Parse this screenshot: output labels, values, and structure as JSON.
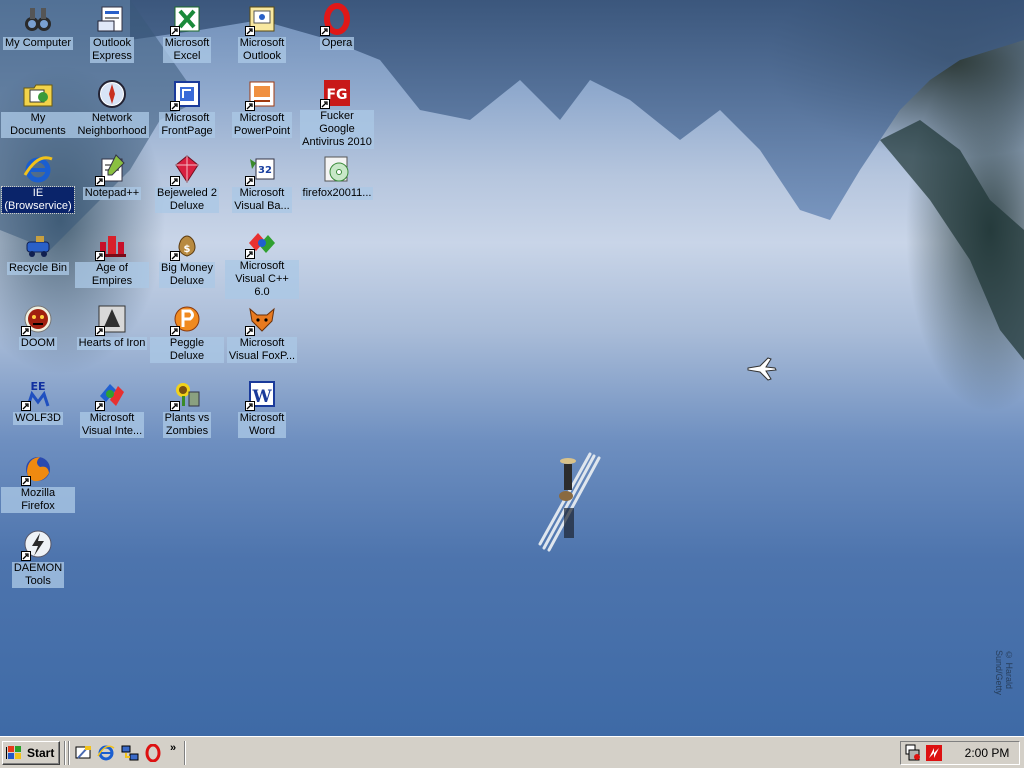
{
  "desktop": {
    "credit_text": "© Harald Sund/Getty",
    "icons": [
      {
        "label": "My Computer",
        "icon": "binoculars-computer-icon"
      },
      {
        "label": "My Documents",
        "icon": "documents-folder-icon"
      },
      {
        "label": "IE\n(Browservice)",
        "icon": "internet-explorer-icon",
        "selected": true
      },
      {
        "label": "Recycle Bin",
        "icon": "recycle-bin-icon"
      },
      {
        "label": "DOOM",
        "icon": "doom-icon"
      },
      {
        "label": "WOLF3D",
        "icon": "wolf3d-icon"
      },
      {
        "label": "Mozilla Firefox",
        "icon": "firefox-icon"
      },
      {
        "label": "DAEMON\nTools",
        "icon": "daemon-tools-icon"
      },
      {
        "label": "Outlook\nExpress",
        "icon": "outlook-express-icon"
      },
      {
        "label": "Network\nNeighborhood",
        "icon": "network-neighborhood-icon"
      },
      {
        "label": "Notepad++",
        "icon": "notepad-plus-plus-icon"
      },
      {
        "label": "Age of Empires",
        "icon": "age-of-empires-icon"
      },
      {
        "label": "Hearts of Iron",
        "icon": "hearts-of-iron-icon"
      },
      {
        "label": "Microsoft\nVisual Inte...",
        "icon": "visual-interdev-icon"
      },
      {
        "label": "Microsoft\nExcel",
        "icon": "excel-icon"
      },
      {
        "label": "Microsoft\nFrontPage",
        "icon": "frontpage-icon"
      },
      {
        "label": "Bejeweled 2\nDeluxe",
        "icon": "bejeweled-icon"
      },
      {
        "label": "Big Money\nDeluxe",
        "icon": "big-money-icon"
      },
      {
        "label": "Peggle Deluxe",
        "icon": "peggle-icon"
      },
      {
        "label": "Plants vs\nZombies",
        "icon": "plants-vs-zombies-icon"
      },
      {
        "label": "Microsoft\nOutlook",
        "icon": "outlook-icon"
      },
      {
        "label": "Microsoft\nPowerPoint",
        "icon": "powerpoint-icon"
      },
      {
        "label": "Microsoft\nVisual Ba...",
        "icon": "visual-basic-icon"
      },
      {
        "label": "Microsoft\nVisual C++ 6.0",
        "icon": "visual-cpp-icon"
      },
      {
        "label": "Microsoft\nVisual FoxP...",
        "icon": "visual-foxpro-icon"
      },
      {
        "label": "Microsoft\nWord",
        "icon": "word-icon"
      },
      {
        "label": "Opera",
        "icon": "opera-icon"
      },
      {
        "label": "Fucker Google\nAntivirus 2010",
        "icon": "fg-antivirus-icon"
      },
      {
        "label": "firefox20011...",
        "icon": "cd-installer-icon"
      }
    ]
  },
  "taskbar": {
    "start_label": "Start",
    "quick_launch": [
      "show-desktop-icon",
      "internet-explorer-icon",
      "network-icon",
      "opera-icon"
    ],
    "more_label": "»",
    "tray_icons": [
      "tray-connection-icon",
      "tray-antivirus-icon"
    ],
    "clock": "2:00 PM"
  },
  "colors": {
    "taskbar": "#d4d0c8",
    "selection": "#0a246a",
    "label_bg": "#aac8e6"
  }
}
